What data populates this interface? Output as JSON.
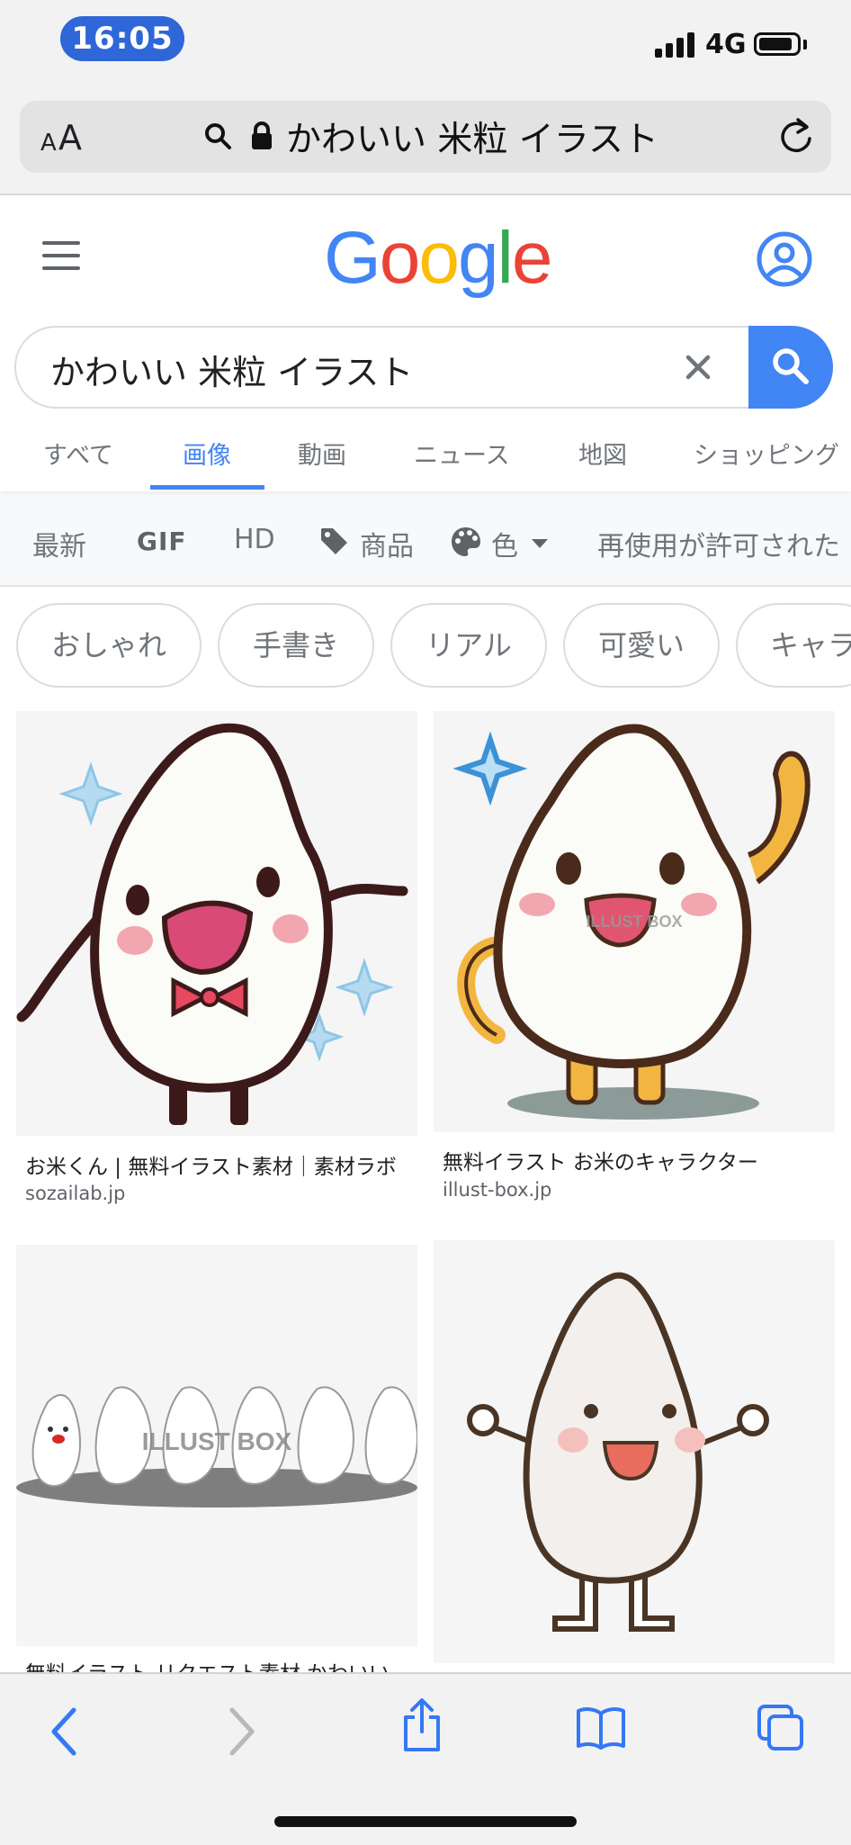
{
  "status_bar": {
    "time": "16:05",
    "network": "4G"
  },
  "url_bar": {
    "aa_small": "A",
    "aa_large": "A",
    "query": "かわいい 米粒 イラスト"
  },
  "google": {
    "logo_letters": [
      {
        "char": "G",
        "color": "#4285F4"
      },
      {
        "char": "o",
        "color": "#EA4335"
      },
      {
        "char": "o",
        "color": "#FBBC05"
      },
      {
        "char": "g",
        "color": "#4285F4"
      },
      {
        "char": "l",
        "color": "#34A853"
      },
      {
        "char": "e",
        "color": "#EA4335"
      }
    ],
    "accent": "#4285F4"
  },
  "search": {
    "value": "かわいい 米粒 イラスト"
  },
  "tabs": [
    {
      "label": "すべて"
    },
    {
      "label": "画像",
      "active": true
    },
    {
      "label": "動画"
    },
    {
      "label": "ニュース"
    },
    {
      "label": "地図"
    },
    {
      "label": "ショッピング"
    }
  ],
  "tools": {
    "latest": "最新",
    "gif": "GIF",
    "hd": "HD",
    "product": "商品",
    "color": "色",
    "reuse": "再使用が許可された"
  },
  "chips": [
    "おしゃれ",
    "手書き",
    "リアル",
    "可愛い",
    "キャラ"
  ],
  "results": [
    {
      "title": "お米くん | 無料イラスト素材｜素材ラボ",
      "source": "sozailab.jp"
    },
    {
      "title": "無料イラスト お米のキャラクター",
      "source": "illust-box.jp",
      "watermark": "ILLUST BOX"
    },
    {
      "title": "無料イラスト リクエスト素材 かわいい",
      "source": "",
      "watermark": "ILLUST BOX"
    },
    {
      "title": "",
      "source": ""
    }
  ],
  "icons": {
    "search": "search-icon",
    "lock": "lock-icon",
    "reload": "reload-icon",
    "menu": "menu-icon",
    "account": "account-icon",
    "clear": "clear-icon",
    "tag": "tag-icon",
    "palette": "palette-icon",
    "back": "back-icon",
    "forward": "forward-icon",
    "share": "share-icon",
    "bookmarks": "bookmarks-icon",
    "tabs": "tabs-icon"
  }
}
